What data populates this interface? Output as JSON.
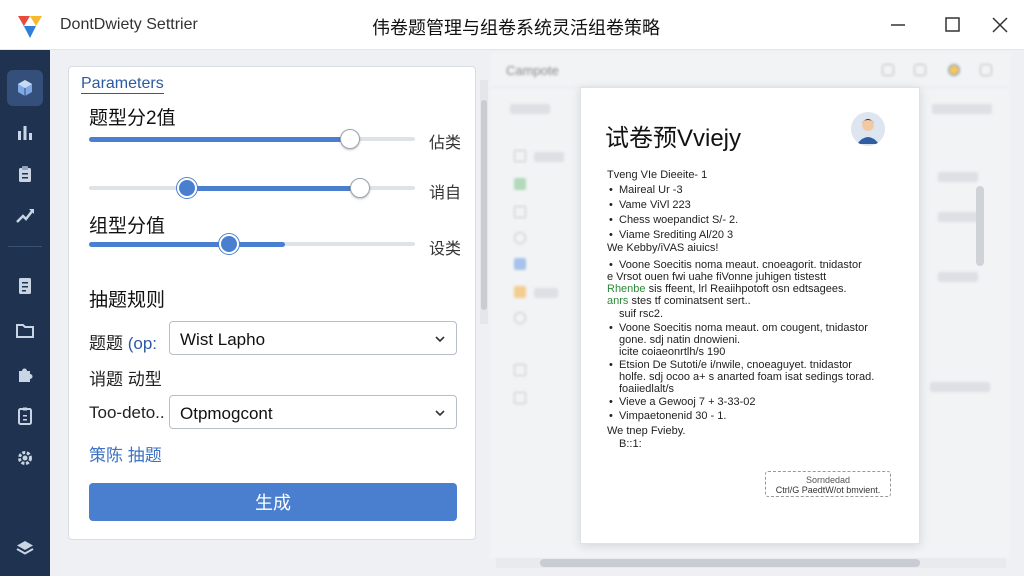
{
  "window": {
    "app_name": "DontDwiety Settrier",
    "title": "伟卷题管理与组卷系统灵活组卷策略"
  },
  "sidebar": {
    "items": [
      {
        "icon": "cube-icon",
        "active": true
      },
      {
        "icon": "bar-chart-icon"
      },
      {
        "icon": "clipboard-icon"
      },
      {
        "icon": "trend-icon"
      },
      {
        "icon": "document-icon"
      },
      {
        "icon": "folder-icon"
      },
      {
        "icon": "puzzle-icon"
      },
      {
        "icon": "checklist-icon"
      },
      {
        "icon": "gear-icon"
      },
      {
        "icon": "layers-icon"
      }
    ]
  },
  "params": {
    "title": "Parameters",
    "section1_label": "题型分2值",
    "slider1": {
      "value": 0.8,
      "caption": "佔类"
    },
    "slider2": {
      "low": 0.3,
      "high": 0.83,
      "caption": "诮自"
    },
    "section2_label": "组型分值",
    "slider3": {
      "value": 0.43,
      "fill_to": 0.6,
      "caption": "设类"
    },
    "rule_heading": "抽题规则",
    "field1_label": "题题",
    "field1_hint": "(op:",
    "field1_value": "Wist Lapho",
    "field2_heading": "诮题 动型",
    "field3_label": "Too-deto..",
    "field3_value": "Otpmogcont",
    "strategy_link": "策陈 抽题",
    "generate_label": "生成"
  },
  "background": {
    "brand": "Campote"
  },
  "preview": {
    "title": "试卷预Vviejy",
    "section1": "Tveng VIe Dieeite- 1",
    "section1_items": [
      "Maireal Ur -3",
      "Vame ViVl 223",
      "Chess woepandict S/- 2.",
      "Viame Srediting Al/20 3"
    ],
    "section2": "We Kebby/iVAS aiuics!",
    "para1": [
      "Voone Soecitis noma meaut. cnoeagorit. tnidastor",
      "e Vrsot ouen fwi uahe fiVonne juhigen tistestt",
      "sis ffeent, lrl Reaiihpotoft osn edtsagees.",
      "stes tf cominatsent sert.."
    ],
    "para1_green": "Rhenbe",
    "para1_green_start": "anrs",
    "para2_first": "suif rsc2.",
    "para2": [
      "Voone Soecitis noma meaut. om cougent, tnidastor",
      "gone. sdj natin dnowieni.",
      "icite coiaeonrtlh/s 190"
    ],
    "para3": [
      "Etsion De Sutoti/e i/nwile, cnoeaguyet. tnidastor",
      "holfe. sdj ocoo a+ s anarted foam isat sedings torad.",
      "foaiiedlalt/s"
    ],
    "section2_items": [
      "Vieve a Gewooj 7 + 3-33-02",
      "Vimpaetonenid 30 - 1."
    ],
    "closing1": "We tnep Fvieby.",
    "closing2": "B::1:",
    "stamp_line1": "Sorndedad",
    "stamp_line2": "Ctrl/G PaedtW/ot bmvient."
  },
  "colors": {
    "accent": "#4a7fd0",
    "sidebar": "#1f3350",
    "link": "#3d72c4"
  }
}
